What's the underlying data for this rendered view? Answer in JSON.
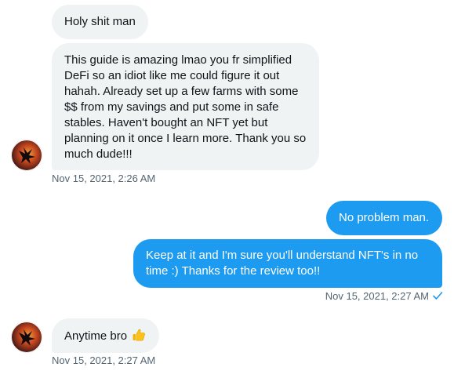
{
  "colors": {
    "incoming_bubble": "#eff3f4",
    "outgoing_bubble": "#1d9bf0",
    "timestamp": "#536471",
    "text": "#0f1419"
  },
  "messages": [
    {
      "direction": "incoming",
      "text": "Holy shit man"
    },
    {
      "direction": "incoming",
      "text": "This guide is amazing lmao you fr simplified DeFi so an idiot like me could figure it out hahah. Already set up a few farms with some $$ from my savings and put some in safe stables. Haven't bought an NFT yet but planning on it once I learn more. Thank you so much dude!!!",
      "timestamp": "Nov 15, 2021, 2:26 AM"
    },
    {
      "direction": "outgoing",
      "text": "No problem man."
    },
    {
      "direction": "outgoing",
      "text": "Keep at it and I'm sure you'll understand NFT's in no time :) Thanks for the review too!!",
      "timestamp": "Nov 15, 2021, 2:27 AM",
      "status_icon": "read-check-icon"
    },
    {
      "direction": "incoming",
      "text": "Anytime bro",
      "emoji_icon": "thumbs-up-icon",
      "timestamp": "Nov 15, 2021, 2:27 AM"
    }
  ]
}
